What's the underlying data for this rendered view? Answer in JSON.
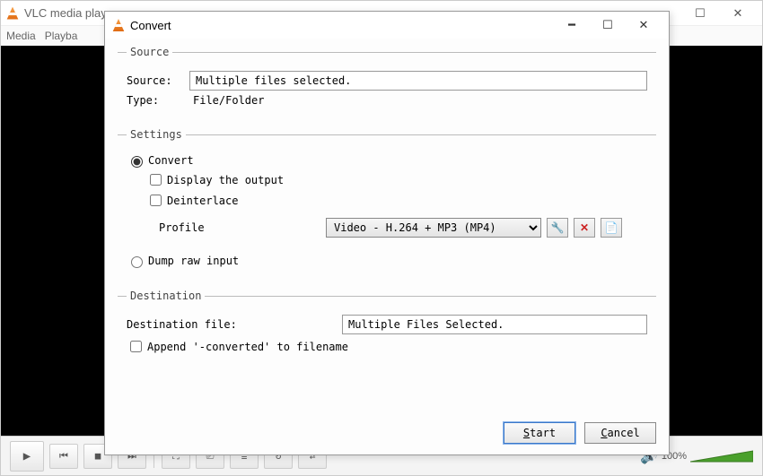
{
  "main_window": {
    "title": "VLC media player",
    "menu": [
      "Media",
      "Playba"
    ]
  },
  "dialog": {
    "title": "Convert",
    "groups": {
      "source": {
        "legend": "Source",
        "source_label": "Source:",
        "source_value": "Multiple files selected.",
        "type_label": "Type:",
        "type_value": "File/Folder"
      },
      "settings": {
        "legend": "Settings",
        "radio_convert": "Convert",
        "check_display": "Display the output",
        "check_deinterlace": "Deinterlace",
        "profile_label": "Profile",
        "profile_value": "Video - H.264 + MP3 (MP4)",
        "radio_dump": "Dump raw input"
      },
      "destination": {
        "legend": "Destination",
        "dest_label": "Destination file:",
        "dest_value": "Multiple Files Selected.",
        "check_append": "Append '-converted' to filename"
      }
    },
    "buttons": {
      "start": "Start",
      "cancel": "Cancel"
    },
    "icon_buttons": {
      "wrench": "wrench-icon",
      "delete": "delete-icon",
      "new": "new-profile-icon"
    }
  },
  "player_bar": {
    "volume_text": "100%"
  }
}
